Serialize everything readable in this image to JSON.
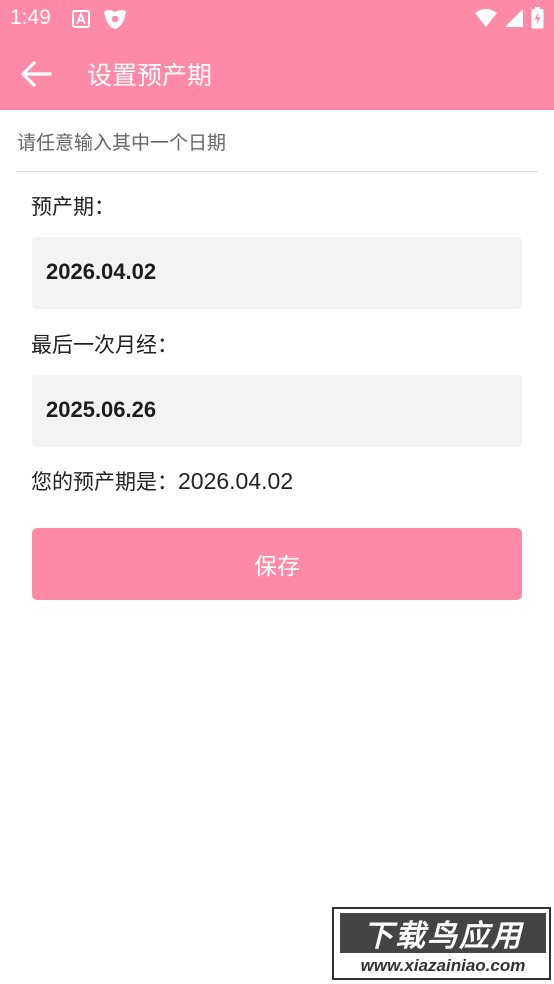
{
  "status_bar": {
    "time": "1:49",
    "left_icons": [
      "font-a-icon",
      "shield-app-icon"
    ],
    "right_icons": [
      "wifi-icon",
      "signal-icon",
      "battery-charging-icon"
    ]
  },
  "app_bar": {
    "title": "设置预产期",
    "back_icon": "arrow-left-icon"
  },
  "form": {
    "hint": "请任意输入其中一个日期",
    "due_date_label": "预产期：",
    "due_date_value": "2026.04.02",
    "last_period_label": "最后一次月经：",
    "last_period_value": "2025.06.26",
    "result_prefix": "您的预产期是：",
    "result_value": "2026.04.02",
    "save_label": "保存"
  },
  "watermark": {
    "cn_text": "下载鸟应用",
    "en_text": "www.xiazainiao.com"
  },
  "colors": {
    "accent": "#ff8aa7",
    "field_bg": "#f3f3f3",
    "text": "#222222",
    "hint_text": "#666666"
  }
}
